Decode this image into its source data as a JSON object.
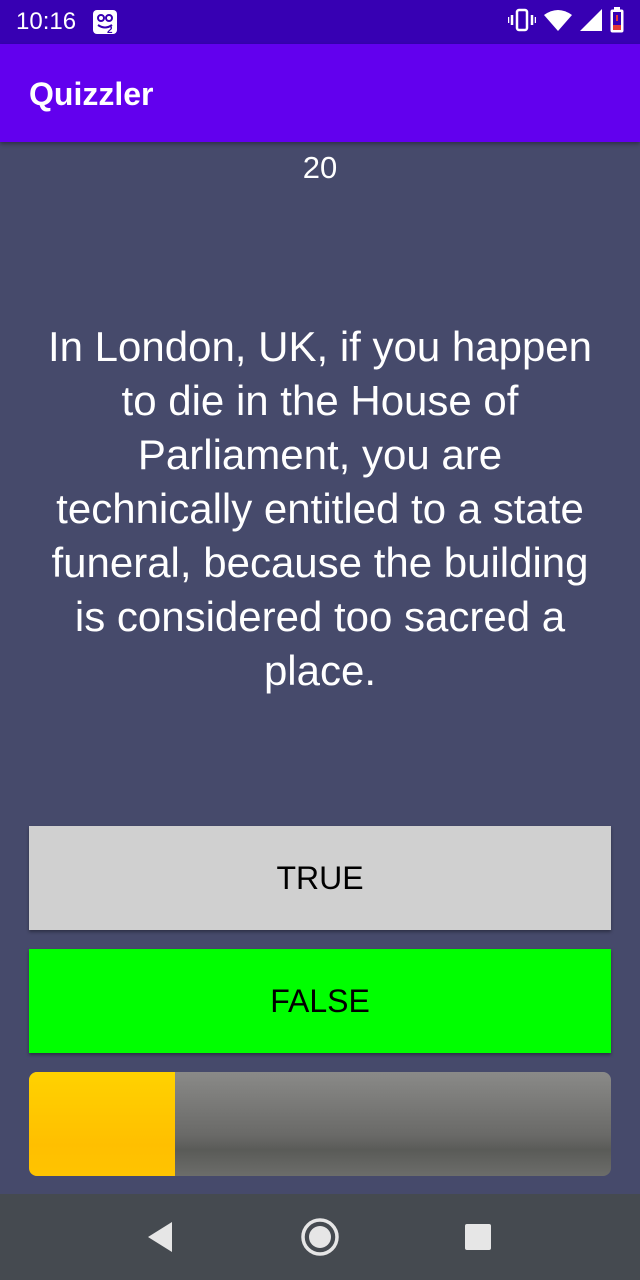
{
  "status_bar": {
    "time": "10:16",
    "notification_icon": "emulator-notification-icon",
    "icons": [
      "vibrate-icon",
      "wifi-icon",
      "cell-signal-icon",
      "battery-low-icon"
    ]
  },
  "app_bar": {
    "title": "Quizzler",
    "color": "#6200ee"
  },
  "quiz": {
    "score": "20",
    "question": "In London, UK, if you happen to die in the House of Parliament, you are technically entitled to a state funeral, because the building is considered too sacred a place.",
    "true_label": "TRUE",
    "false_label": "FALSE",
    "progress_fraction": 0.25
  },
  "colors": {
    "background": "#464a6b",
    "true_button": "#d0d0d0",
    "false_button": "#00ff00",
    "progress_fill": "#ffc400"
  },
  "nav_bar": {
    "buttons": [
      "back-icon",
      "home-icon",
      "recents-icon"
    ]
  }
}
